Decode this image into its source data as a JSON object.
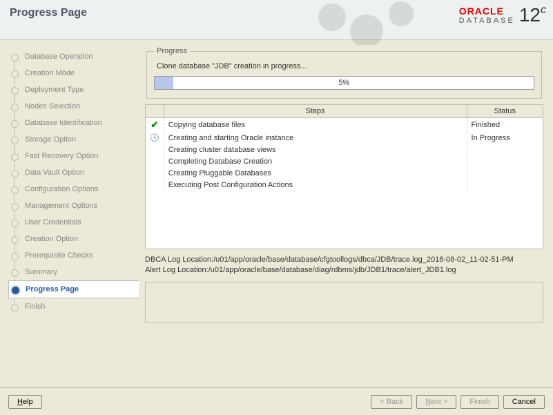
{
  "header": {
    "title": "Progress Page",
    "brand_top": "ORACLE",
    "brand_bottom": "DATABASE",
    "version": "12",
    "version_suffix": "c"
  },
  "sidebar": {
    "steps": [
      {
        "label": "Database Operation",
        "active": false
      },
      {
        "label": "Creation Mode",
        "active": false
      },
      {
        "label": "Deployment Type",
        "active": false
      },
      {
        "label": "Nodes Selection",
        "active": false
      },
      {
        "label": "Database Identification",
        "active": false
      },
      {
        "label": "Storage Option",
        "active": false
      },
      {
        "label": "Fast Recovery Option",
        "active": false
      },
      {
        "label": "Data Vault Option",
        "active": false
      },
      {
        "label": "Configuration Options",
        "active": false
      },
      {
        "label": "Management Options",
        "active": false
      },
      {
        "label": "User Credentials",
        "active": false
      },
      {
        "label": "Creation Option",
        "active": false
      },
      {
        "label": "Prerequisite Checks",
        "active": false
      },
      {
        "label": "Summary",
        "active": false
      },
      {
        "label": "Progress Page",
        "active": true
      },
      {
        "label": "Finish",
        "active": false
      }
    ]
  },
  "progress": {
    "legend": "Progress",
    "message": "Clone database \"JDB\" creation in progress...",
    "percent": 5,
    "percent_label": "5%"
  },
  "table": {
    "columns": [
      "",
      "Steps",
      "Status"
    ],
    "rows": [
      {
        "icon": "check",
        "step": "Copying database files",
        "status": "Finished"
      },
      {
        "icon": "clock",
        "step": "Creating and starting Oracle instance",
        "status": "In Progress"
      },
      {
        "icon": "",
        "step": "Creating cluster database views",
        "status": ""
      },
      {
        "icon": "",
        "step": "Completing Database Creation",
        "status": ""
      },
      {
        "icon": "",
        "step": "Creating Pluggable Databases",
        "status": ""
      },
      {
        "icon": "",
        "step": "Executing Post Configuration Actions",
        "status": ""
      }
    ]
  },
  "logs": {
    "line1": "DBCA Log Location:/u01/app/oracle/base/database/cfgtoollogs/dbca/JDB/trace.log_2018-08-02_11-02-51-PM",
    "line2": "Alert Log Location:/u01/app/oracle/base/database/diag/rdbms/jdb/JDB1/trace/alert_JDB1.log"
  },
  "footer": {
    "help": "Help",
    "back": "< Back",
    "next": "Next >",
    "finish": "Finish",
    "cancel": "Cancel"
  }
}
